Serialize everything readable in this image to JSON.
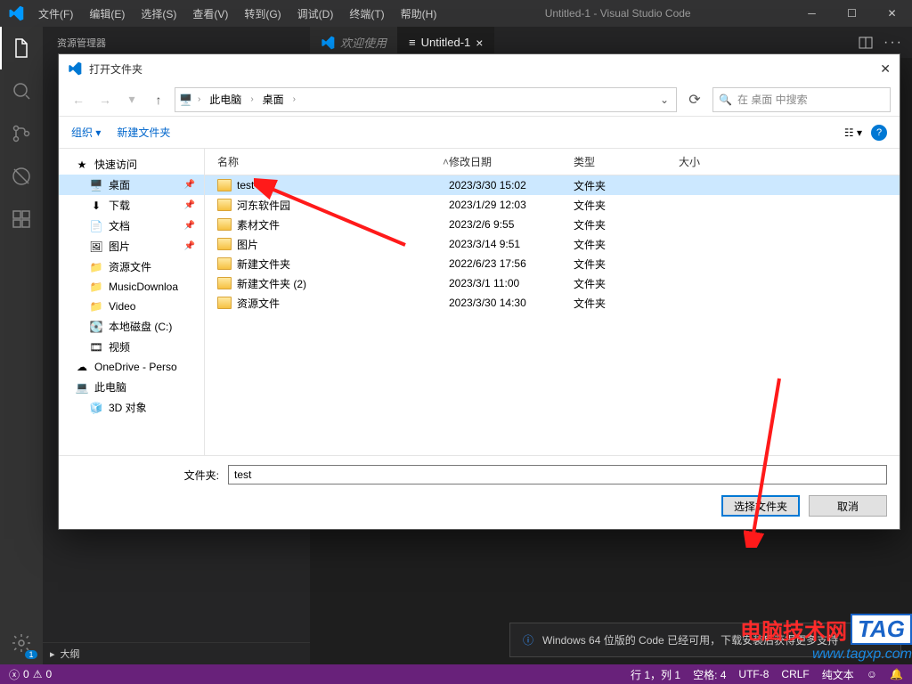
{
  "titlebar": {
    "menus": [
      "文件(F)",
      "编辑(E)",
      "选择(S)",
      "查看(V)",
      "转到(G)",
      "调试(D)",
      "终端(T)",
      "帮助(H)"
    ],
    "title": "Untitled-1 - Visual Studio Code"
  },
  "sidebar": {
    "header": "资源管理器"
  },
  "tabs": {
    "items": [
      {
        "label": "欢迎使用",
        "active": false
      },
      {
        "label": "Untitled-1",
        "active": true
      }
    ]
  },
  "outline": {
    "label": "大纲"
  },
  "statusbar": {
    "errors": "0",
    "warnings": "0",
    "cursor": "行 1，列 1",
    "spaces": "空格: 4",
    "encoding": "UTF-8",
    "eol": "CRLF",
    "lang": "纯文本",
    "feedback": "☺"
  },
  "notification": {
    "text": "Windows 64 位版的 Code 已经可用，下载安装后获得更多支持",
    "close": "×"
  },
  "dialog": {
    "title": "打开文件夹",
    "breadcrumb": [
      "此电脑",
      "桌面"
    ],
    "search_placeholder": "在 桌面 中搜索",
    "toolbar": {
      "organize": "组织 ▾",
      "newfolder": "新建文件夹"
    },
    "columns": {
      "name": "名称",
      "date": "修改日期",
      "type": "类型",
      "size": "大小"
    },
    "tree": [
      {
        "label": "快速访问",
        "icon": "star",
        "level": 1
      },
      {
        "label": "桌面",
        "icon": "desktop",
        "level": 2,
        "selected": true,
        "pinned": true
      },
      {
        "label": "下载",
        "icon": "download",
        "level": 2,
        "pinned": true
      },
      {
        "label": "文档",
        "icon": "doc",
        "level": 2,
        "pinned": true
      },
      {
        "label": "图片",
        "icon": "pic",
        "level": 2,
        "pinned": true
      },
      {
        "label": "资源文件",
        "icon": "folder",
        "level": 2
      },
      {
        "label": "MusicDownloa",
        "icon": "folder",
        "level": 2
      },
      {
        "label": "Video",
        "icon": "folder",
        "level": 2
      },
      {
        "label": "本地磁盘 (C:)",
        "icon": "disk",
        "level": 2
      },
      {
        "label": "视频",
        "icon": "video",
        "level": 2
      },
      {
        "label": "OneDrive - Perso",
        "icon": "cloud",
        "level": 1
      },
      {
        "label": "此电脑",
        "icon": "pc",
        "level": 1
      },
      {
        "label": "3D 对象",
        "icon": "3d",
        "level": 2
      }
    ],
    "files": [
      {
        "name": "test",
        "date": "2023/3/30 15:02",
        "type": "文件夹",
        "selected": true
      },
      {
        "name": "河东软件园",
        "date": "2023/1/29 12:03",
        "type": "文件夹"
      },
      {
        "name": "素材文件",
        "date": "2023/2/6 9:55",
        "type": "文件夹"
      },
      {
        "name": "图片",
        "date": "2023/3/14 9:51",
        "type": "文件夹"
      },
      {
        "name": "新建文件夹",
        "date": "2022/6/23 17:56",
        "type": "文件夹"
      },
      {
        "name": "新建文件夹 (2)",
        "date": "2023/3/1 11:00",
        "type": "文件夹"
      },
      {
        "name": "资源文件",
        "date": "2023/3/30 14:30",
        "type": "文件夹"
      }
    ],
    "folder_label": "文件夹:",
    "folder_value": "test",
    "btn_select": "选择文件夹",
    "btn_cancel": "取消"
  },
  "watermark": {
    "line1": "电脑技术网",
    "tag": "TAG",
    "line2": "www.tagxp.com"
  },
  "activity_badge": "1"
}
